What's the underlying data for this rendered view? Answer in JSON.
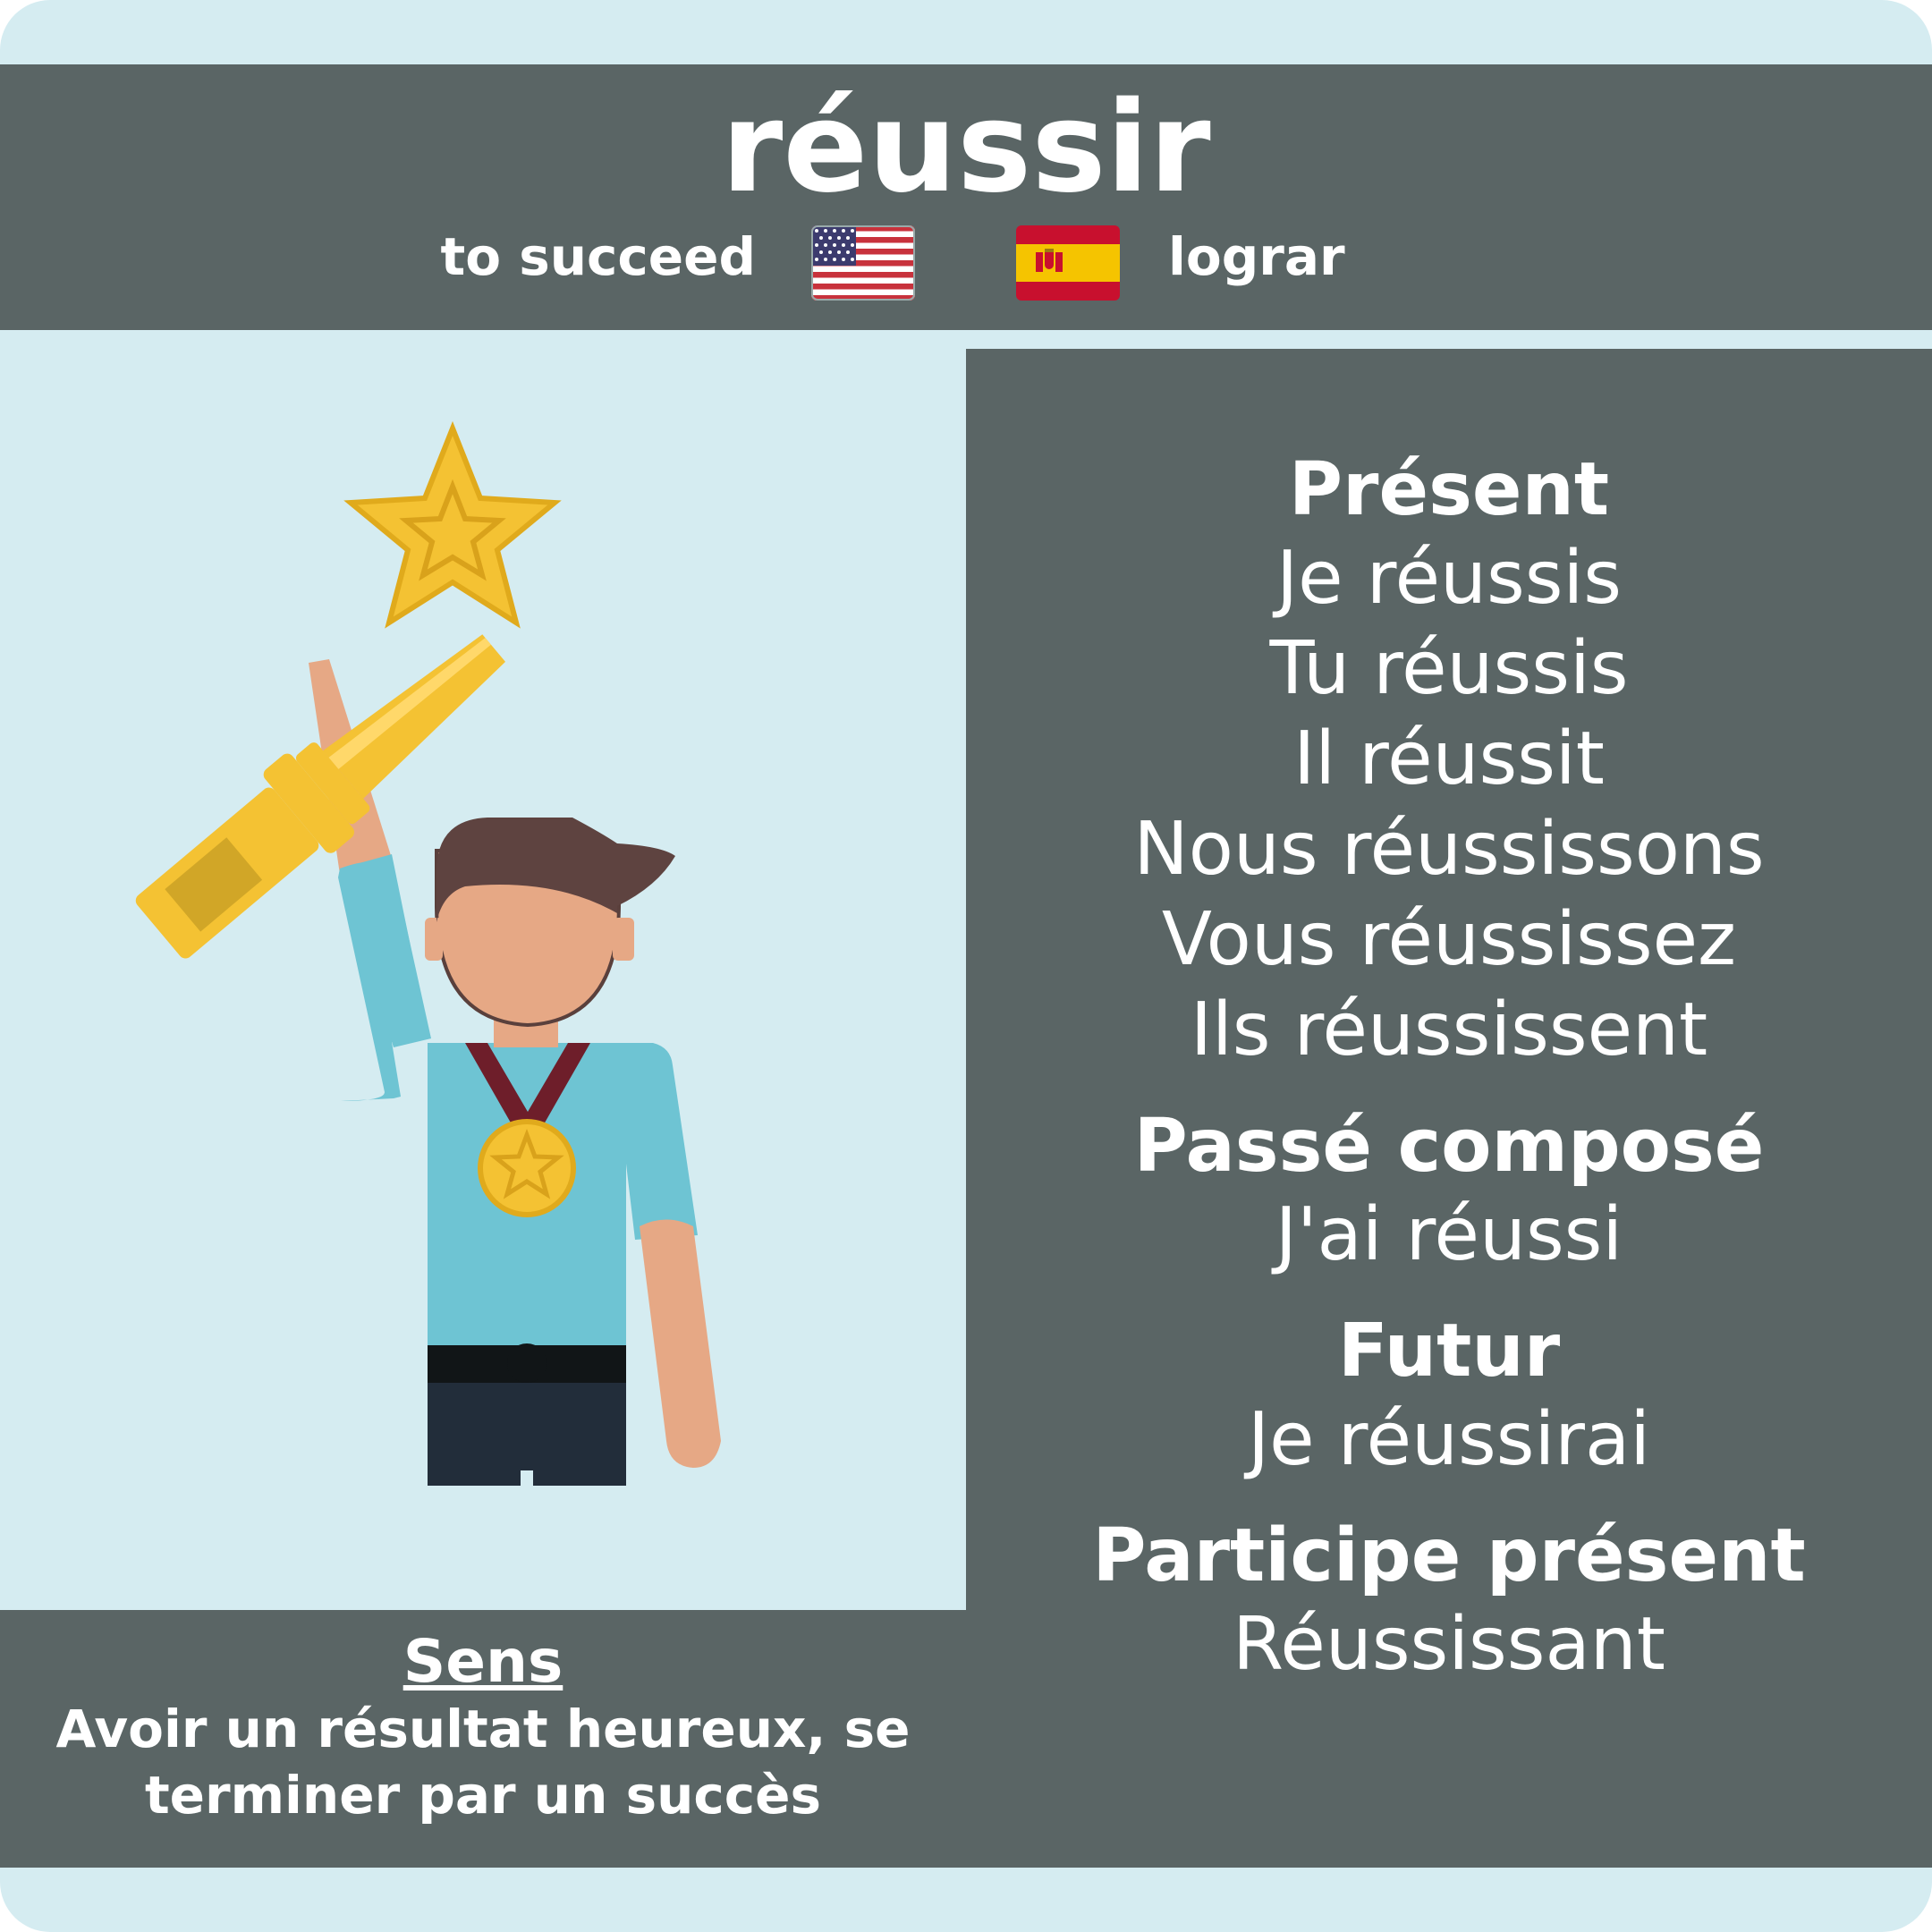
{
  "verb": "réussir",
  "translations": {
    "english": "to succeed",
    "spanish": "lograr"
  },
  "conjugations": {
    "present": {
      "label": "Présent",
      "forms": [
        "Je réussis",
        "Tu réussis",
        "Il réussit",
        "Nous réussissons",
        "Vous réussissez",
        "Ils réussissent"
      ]
    },
    "passe_compose": {
      "label": "Passé composé",
      "form": "J'ai réussi"
    },
    "futur": {
      "label": "Futur",
      "form": "Je réussirai"
    },
    "participe_present": {
      "label": "Participe présent",
      "form": "Réussissant"
    }
  },
  "sens": {
    "title": "Sens",
    "line1": "Avoir un résultat heureux, se",
    "line2": "terminer par un succès"
  },
  "colors": {
    "background": "#d5ecf1",
    "panel": "#5a6565",
    "text": "#ffffff"
  },
  "icons": [
    "us-flag-icon",
    "spain-flag-icon",
    "man-with-trophy-illustration"
  ]
}
